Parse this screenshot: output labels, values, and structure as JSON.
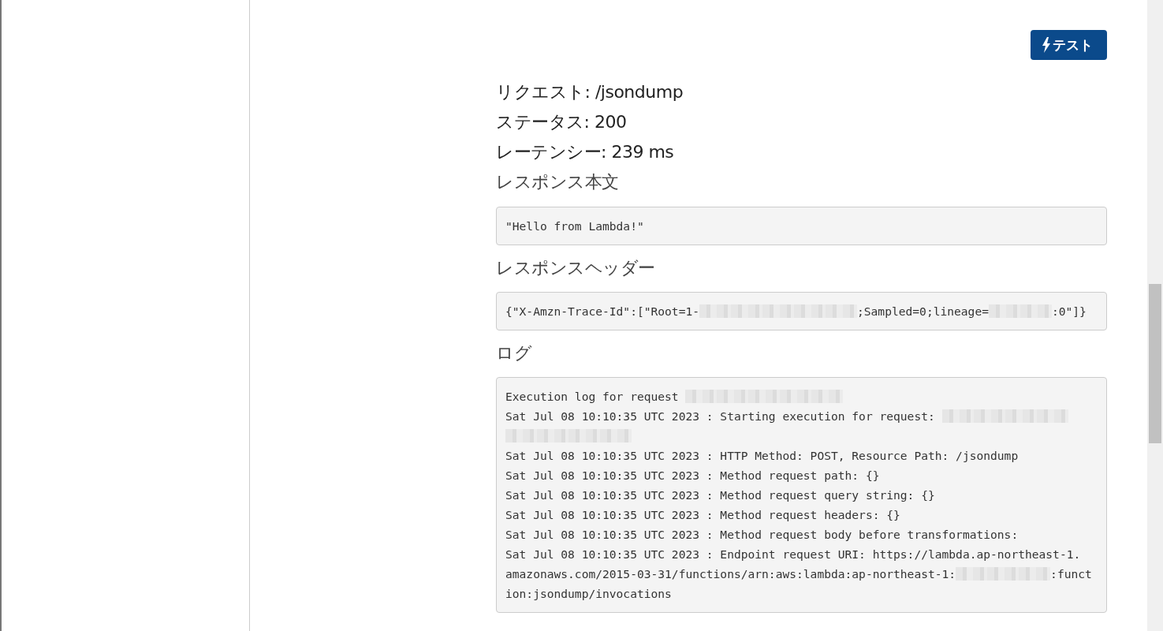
{
  "test_button": {
    "label": "テスト"
  },
  "summary": [
    {
      "label": "リクエスト: /jsondump"
    },
    {
      "label": "ステータス: 200"
    },
    {
      "label": "レーテンシー: 239 ms"
    }
  ],
  "sections": [
    {
      "title": "レスポンス本文",
      "lines": [
        [
          {
            "kind": "text",
            "text": "\"Hello from Lambda!\""
          }
        ]
      ]
    },
    {
      "title": "レスポンスヘッダー",
      "lines": [
        [
          {
            "kind": "text",
            "text": "{\"X-Amzn-Trace-Id\":[\"Root=1-"
          },
          {
            "kind": "redacted"
          },
          {
            "kind": "redacted"
          },
          {
            "kind": "redacted"
          },
          {
            "kind": "redacted"
          },
          {
            "kind": "redacted"
          },
          {
            "kind": "text",
            "text": ";Sampled=0;lineage="
          },
          {
            "kind": "redacted"
          },
          {
            "kind": "redacted"
          },
          {
            "kind": "text",
            "text": ":0\"]}"
          }
        ]
      ]
    },
    {
      "title": "ログ",
      "lines": [
        [
          {
            "kind": "text",
            "text": "Execution log for request "
          },
          {
            "kind": "redacted"
          },
          {
            "kind": "redacted"
          },
          {
            "kind": "redacted"
          },
          {
            "kind": "redacted"
          },
          {
            "kind": "redacted"
          }
        ],
        [
          {
            "kind": "text",
            "text": "Sat Jul 08 10:10:35 UTC 2023 : Starting execution for request: "
          },
          {
            "kind": "redacted"
          },
          {
            "kind": "redacted"
          },
          {
            "kind": "redacted"
          },
          {
            "kind": "redacted"
          },
          {
            "kind": "redacted"
          },
          {
            "kind": "redacted"
          },
          {
            "kind": "redacted"
          },
          {
            "kind": "redacted"
          }
        ],
        [
          {
            "kind": "text",
            "text": "Sat Jul 08 10:10:35 UTC 2023 : HTTP Method: POST, Resource Path: /jsondump"
          }
        ],
        [
          {
            "kind": "text",
            "text": "Sat Jul 08 10:10:35 UTC 2023 : Method request path: {}"
          }
        ],
        [
          {
            "kind": "text",
            "text": "Sat Jul 08 10:10:35 UTC 2023 : Method request query string: {}"
          }
        ],
        [
          {
            "kind": "text",
            "text": "Sat Jul 08 10:10:35 UTC 2023 : Method request headers: {}"
          }
        ],
        [
          {
            "kind": "text",
            "text": "Sat Jul 08 10:10:35 UTC 2023 : Method request body before transformations:"
          }
        ],
        [
          {
            "kind": "text",
            "text": "Sat Jul 08 10:10:35 UTC 2023 : Endpoint request URI: https://lambda.ap-northeast-1."
          }
        ],
        [
          {
            "kind": "text",
            "text": "amazonaws.com/2015-03-31/functions/arn:aws:lambda:ap-northeast-1:"
          },
          {
            "kind": "redacted"
          },
          {
            "kind": "redacted"
          },
          {
            "kind": "redacted"
          },
          {
            "kind": "text",
            "text": ":funct"
          }
        ],
        [
          {
            "kind": "text",
            "text": "ion:jsondump/invocations"
          }
        ]
      ]
    }
  ]
}
